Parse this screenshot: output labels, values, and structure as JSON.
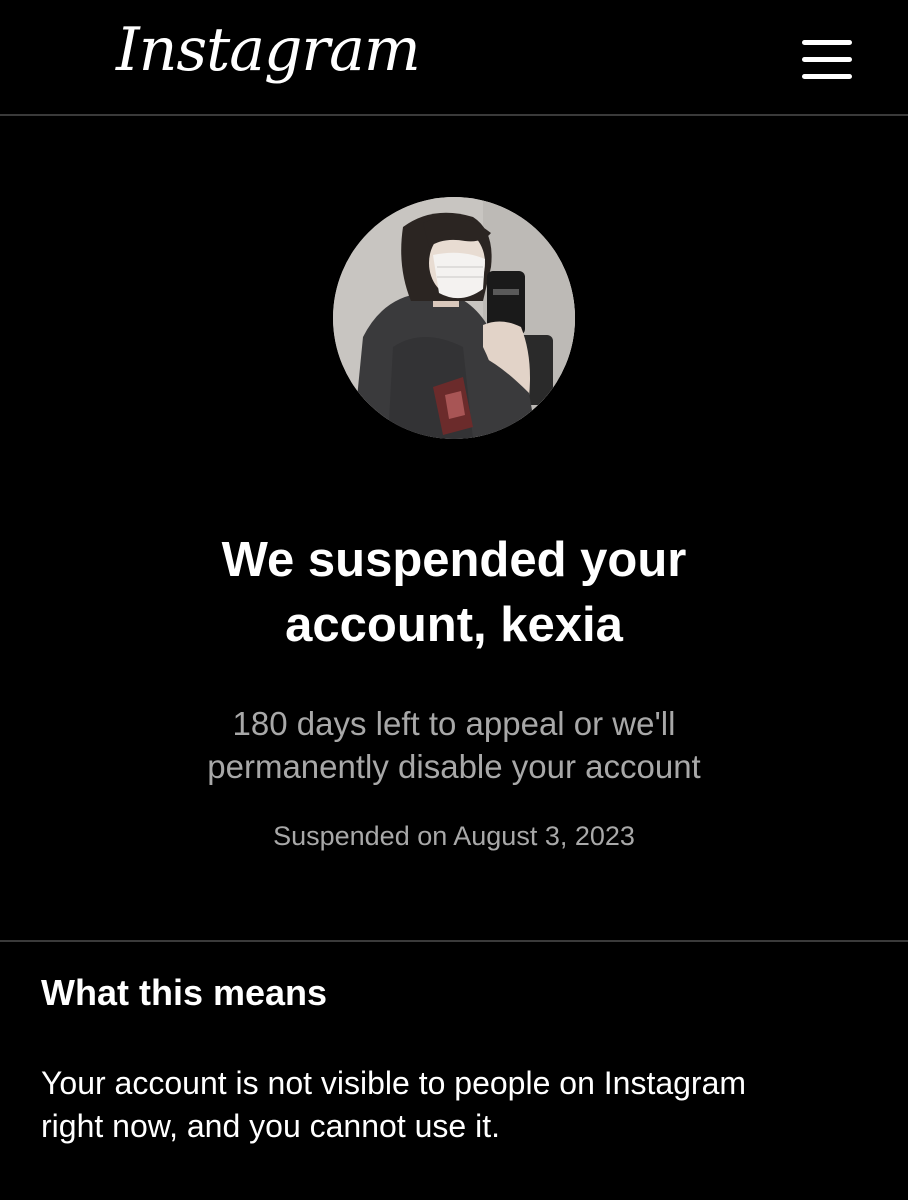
{
  "header": {
    "logo_text": "Instagram",
    "menu_icon": "hamburger-menu-icon"
  },
  "profile": {
    "avatar_description": "profile-photo"
  },
  "notice": {
    "title_line1": "We suspended your",
    "title_line2": "account, kexia",
    "subtitle_line1": "180 days left to appeal or we'll",
    "subtitle_line2": "permanently disable your account",
    "suspended_date": "Suspended on August 3, 2023"
  },
  "what_this_means": {
    "heading": "What this means",
    "body_line1": "Your account is not visible to people on Instagram",
    "body_line2": "right now, and you cannot use it."
  },
  "colors": {
    "background": "#000000",
    "primary_text": "#ffffff",
    "secondary_text": "#a8a8a8",
    "divider": "#3a3a3a"
  }
}
